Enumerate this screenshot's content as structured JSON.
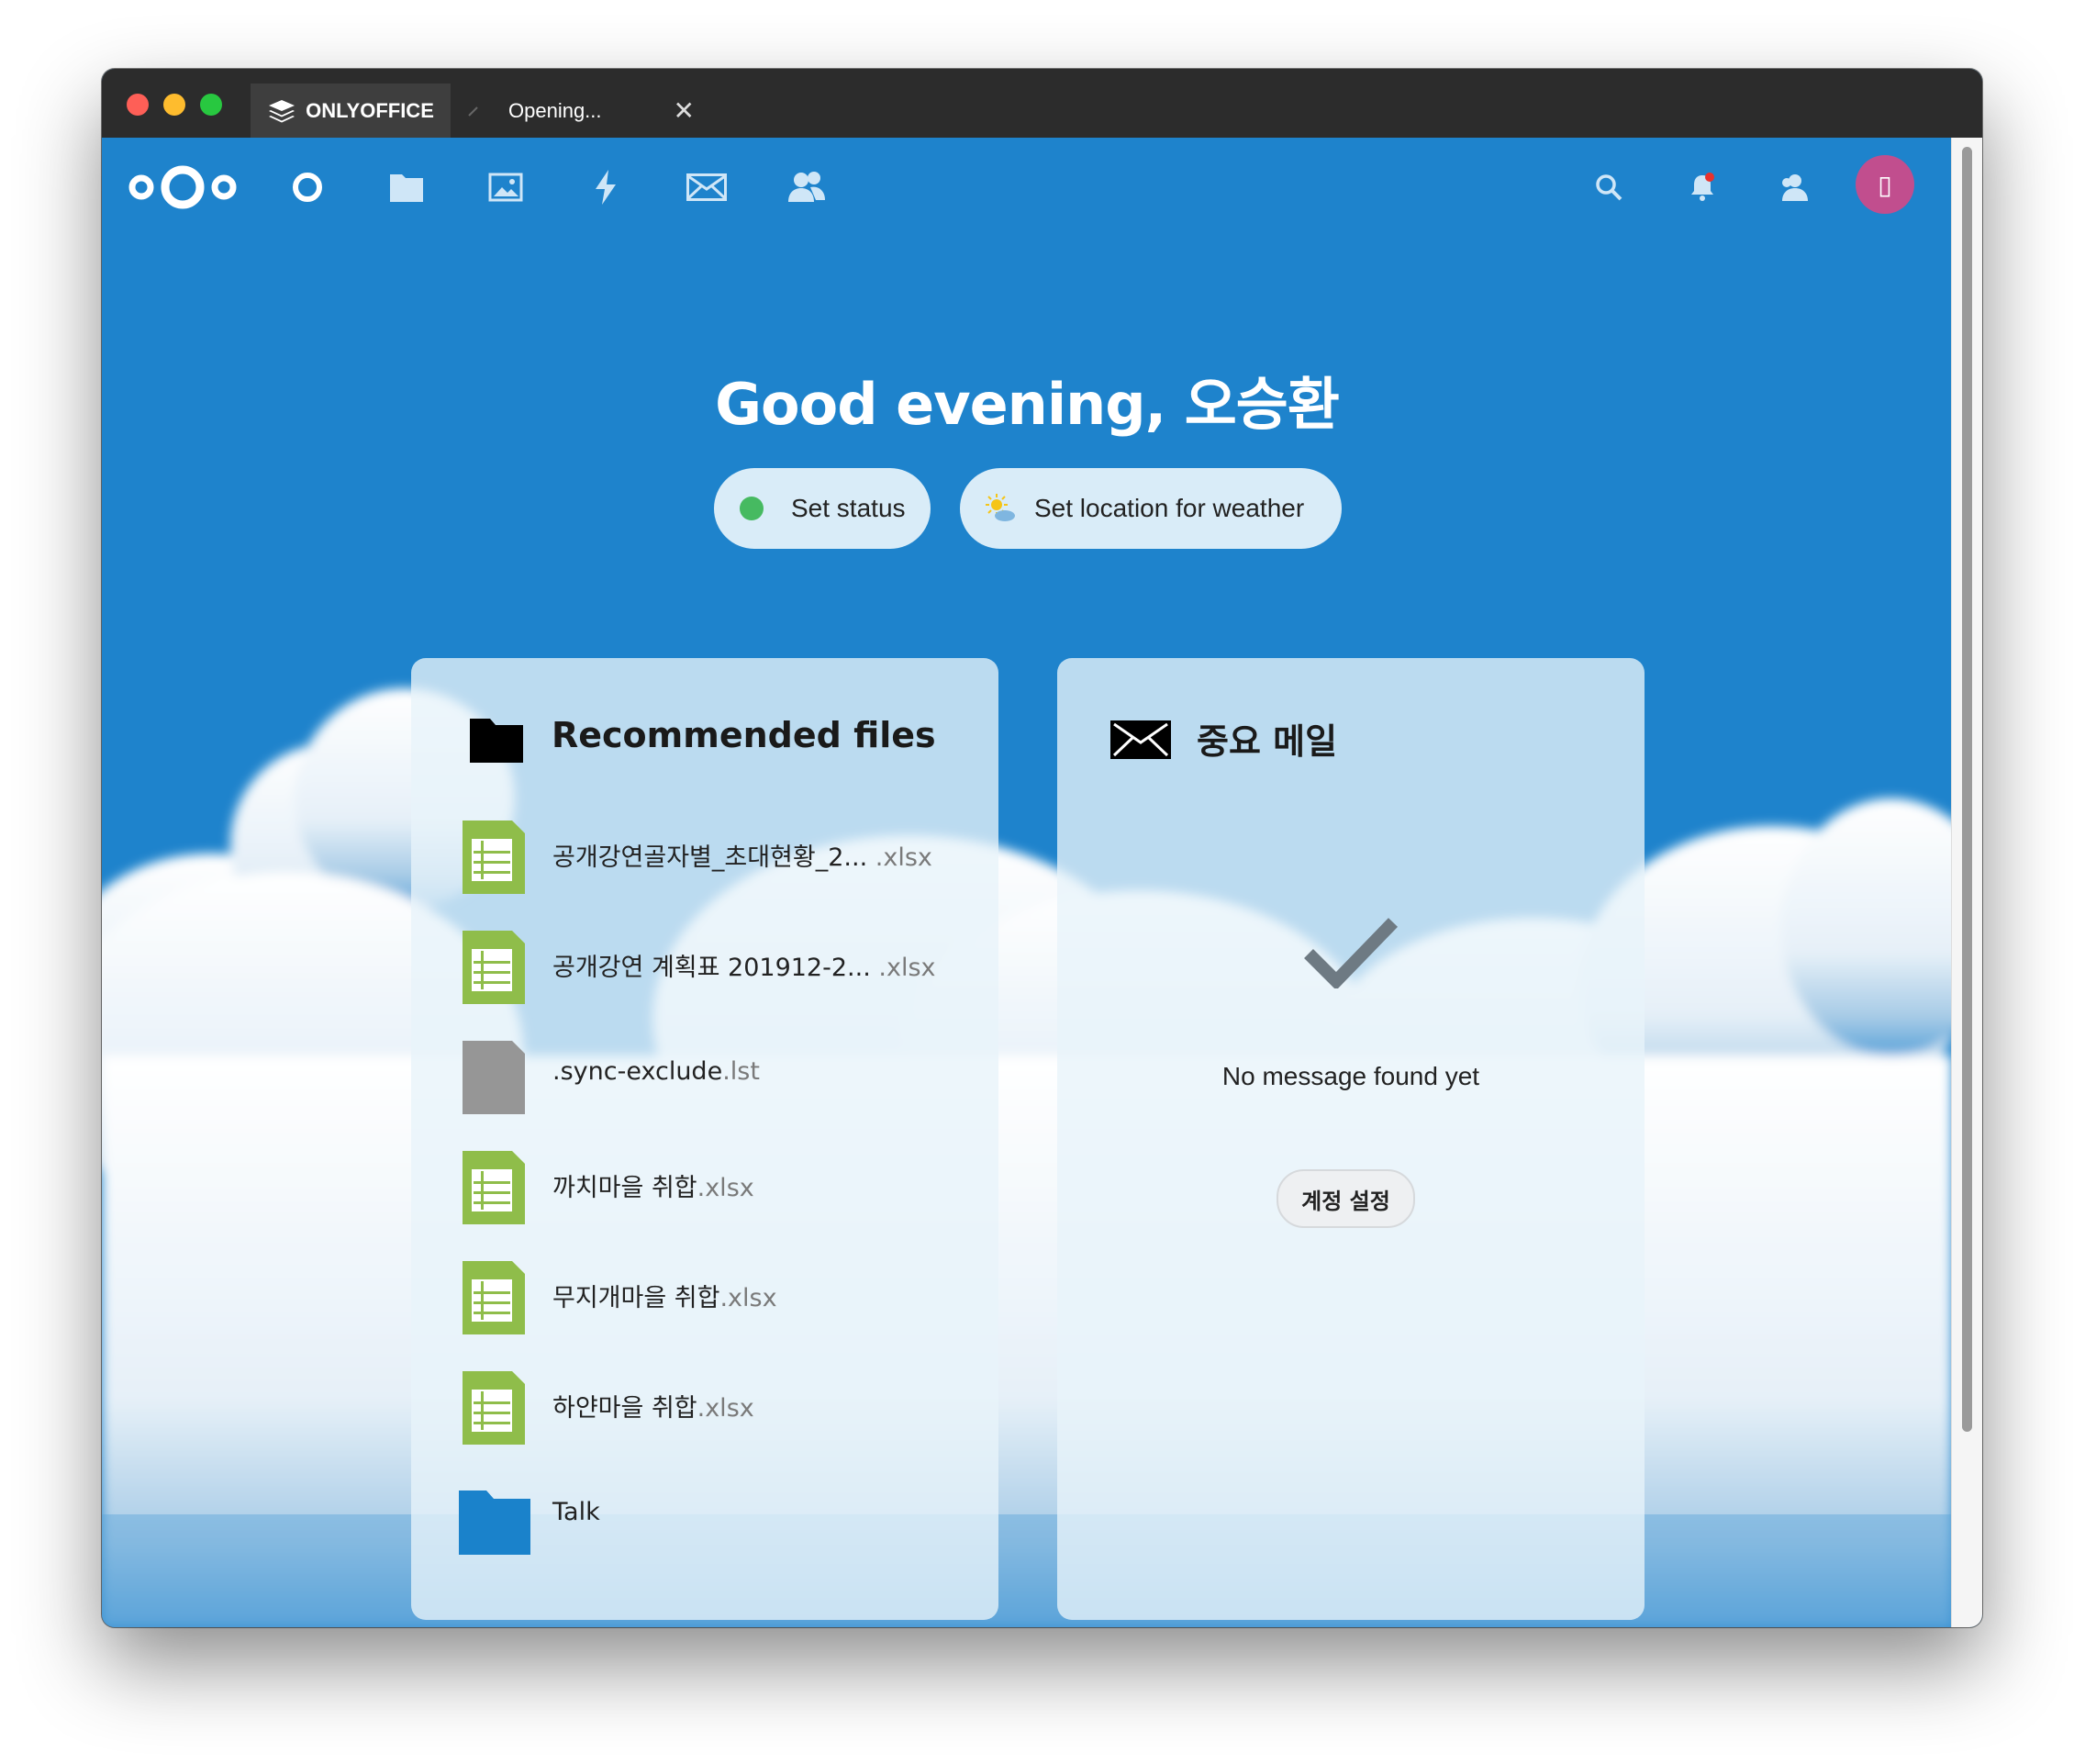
{
  "window": {
    "tabs": [
      {
        "label": "ONLYOFFICE",
        "icon": "onlyoffice-logo-icon"
      },
      {
        "label": "Opening...",
        "close": "✕"
      }
    ]
  },
  "header": {
    "nav_icons": [
      "nextcloud-logo-icon",
      "dashboard-icon",
      "files-icon",
      "photos-icon",
      "activity-icon",
      "mail-icon",
      "contacts-icon"
    ],
    "right_icons": [
      "search-icon",
      "notifications-icon",
      "contacts-menu-icon"
    ],
    "avatar_glyph": "▯",
    "accent": "#1e83cc"
  },
  "dashboard": {
    "greeting": "Good evening, 오승환",
    "set_status": "Set status",
    "set_weather": "Set location for weather"
  },
  "recommended": {
    "title": "Recommended files",
    "files": [
      {
        "name": "공개강연골자별_초대현황_2...",
        "ext": " .xlsx",
        "type": "spreadsheet"
      },
      {
        "name": "공개강연 계획표 201912-2...",
        "ext": " .xlsx",
        "type": "spreadsheet"
      },
      {
        "name": ".sync-exclude",
        "ext": ".lst",
        "type": "generic"
      },
      {
        "name": "까치마을 취합",
        "ext": ".xlsx",
        "type": "spreadsheet"
      },
      {
        "name": "무지개마을 취합",
        "ext": ".xlsx",
        "type": "spreadsheet"
      },
      {
        "name": "하얀마을 취합",
        "ext": ".xlsx",
        "type": "spreadsheet"
      },
      {
        "name": "Talk",
        "ext": "",
        "type": "folder"
      }
    ]
  },
  "mail": {
    "title": "중요 메일",
    "empty_message": "No message found yet",
    "account_button": "계정 설정"
  }
}
